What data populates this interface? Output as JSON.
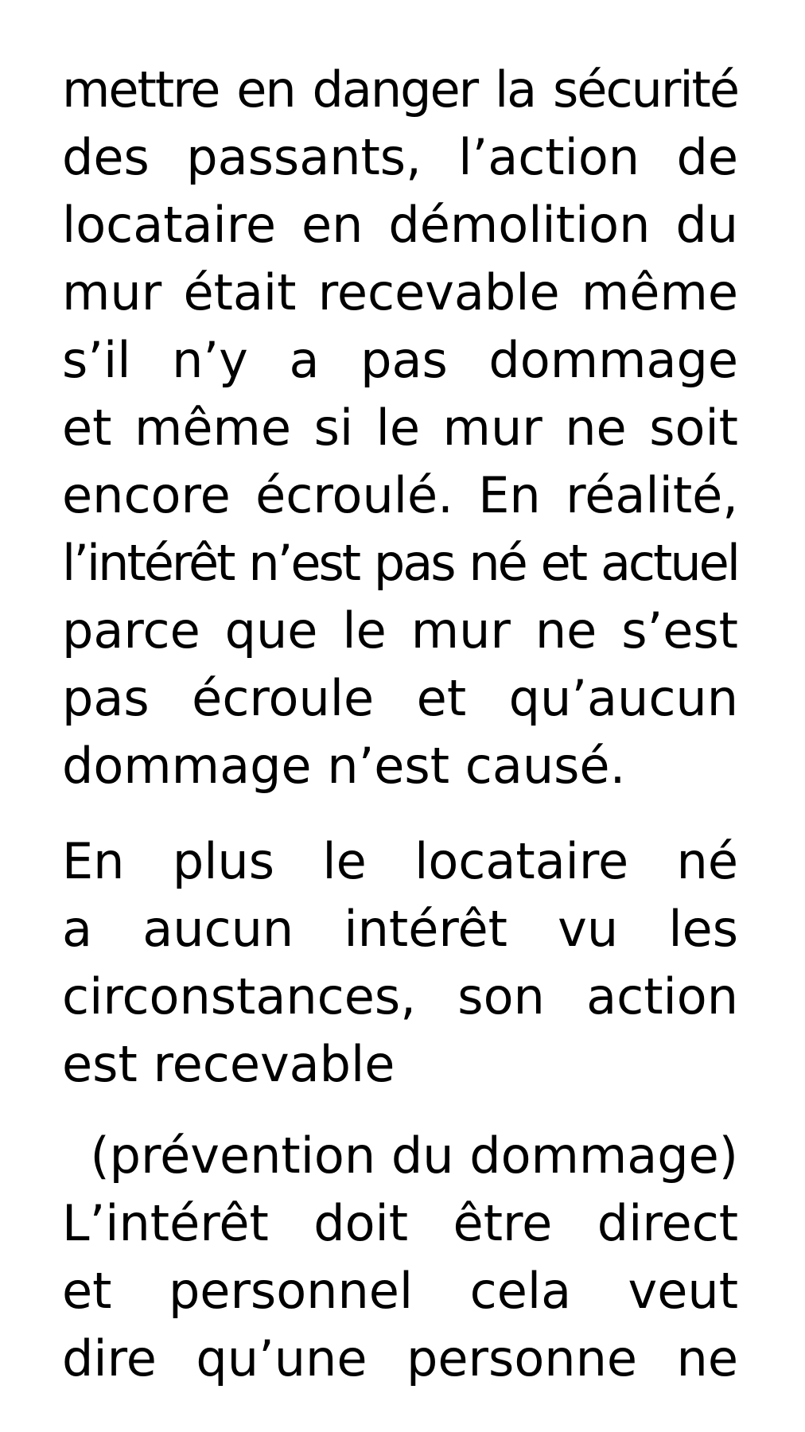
{
  "document": {
    "paragraphs": [
      {
        "lines": [
          "mettre en danger la sécurité",
          "des passants, l’action de",
          "locataire en démolition du",
          "mur était recevable même",
          "s’il n’y a pas dommage",
          "et même si le mur ne soit",
          "encore écroulé. En réalité,",
          "l’intérêt n’est pas né et actuel",
          "parce que le mur ne s’est",
          "pas écroule et qu’aucun",
          "dommage n’est causé."
        ]
      },
      {
        "lines": [
          "En plus le locataire né",
          "a aucun intérêt vu les",
          "circonstances, son action",
          "est recevable"
        ]
      },
      {
        "lines": [
          "(prévention du dommage)",
          "L’intérêt doit être direct",
          "et personnel cela veut",
          "dire qu’une personne ne"
        ]
      }
    ]
  }
}
